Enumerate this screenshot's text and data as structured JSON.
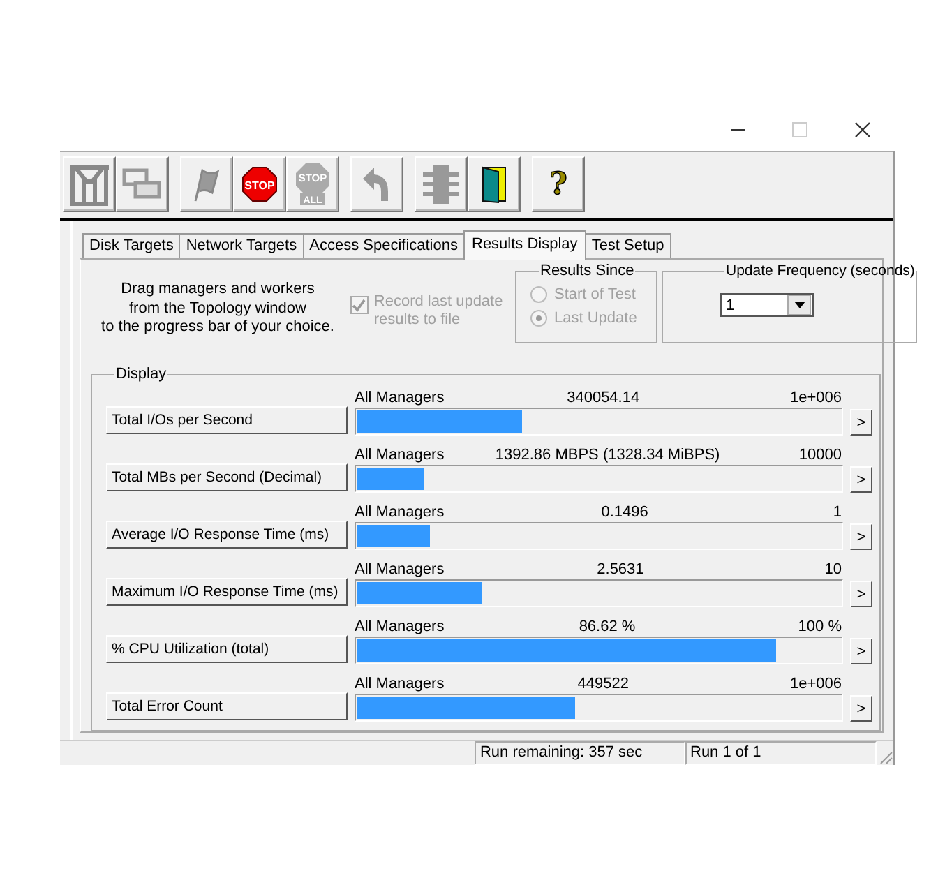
{
  "toolbar": {
    "groups": [
      [
        {
          "kind": "topology"
        },
        {
          "kind": "workers"
        }
      ],
      [
        {
          "kind": "flag"
        },
        {
          "kind": "stop"
        },
        {
          "kind": "stopall"
        }
      ],
      [
        {
          "kind": "reset"
        }
      ],
      [
        {
          "kind": "merge"
        },
        {
          "kind": "exit"
        }
      ],
      [
        {
          "kind": "help"
        }
      ]
    ],
    "stop_label": "STOP",
    "stop_all_label": [
      "STOP",
      "ALL"
    ],
    "help_label": "?"
  },
  "tabs": [
    {
      "label": "Disk Targets",
      "selected": false
    },
    {
      "label": "Network Targets",
      "selected": false
    },
    {
      "label": "Access Specifications",
      "selected": false
    },
    {
      "label": "Results Display",
      "selected": true
    },
    {
      "label": "Test Setup",
      "selected": false
    }
  ],
  "instructions": [
    "Drag managers and workers",
    "from the Topology window",
    "to the progress bar of your choice."
  ],
  "record": {
    "label": [
      "Record last update",
      "results to file"
    ],
    "checked": true,
    "disabled": true
  },
  "results_since": {
    "title": "Results Since",
    "disabled": true,
    "options": [
      {
        "label": "Start of Test",
        "selected": false
      },
      {
        "label": "Last Update",
        "selected": true
      }
    ]
  },
  "update_frequency": {
    "title": "Update Frequency (seconds)",
    "value": "1"
  },
  "display": {
    "title": "Display",
    "arrow": ">",
    "rows": [
      {
        "button": "Total I/Os per Second",
        "source": "All Managers",
        "value": "340054.14",
        "max": "1e+006",
        "level": 0.34
      },
      {
        "button": "Total MBs per Second (Decimal)",
        "source": "All Managers",
        "value": "1392.86 MBPS (1328.34 MiBPS)",
        "max": "10000",
        "level": 0.139
      },
      {
        "button": "Average I/O Response Time (ms)",
        "source": "All Managers",
        "value": "0.1496",
        "max": "1",
        "level": 0.15
      },
      {
        "button": "Maximum I/O Response Time (ms)",
        "source": "All Managers",
        "value": "2.5631",
        "max": "10",
        "level": 0.256
      },
      {
        "button": "% CPU Utilization (total)",
        "source": "All Managers",
        "value": "86.62 %",
        "max": "100 %",
        "level": 0.866
      },
      {
        "button": "Total Error Count",
        "source": "All Managers",
        "value": "449522",
        "max": "1e+006",
        "level": 0.45
      }
    ]
  },
  "status_bar": {
    "remaining": "Run remaining: 357 sec",
    "run": "Run 1 of 1"
  }
}
